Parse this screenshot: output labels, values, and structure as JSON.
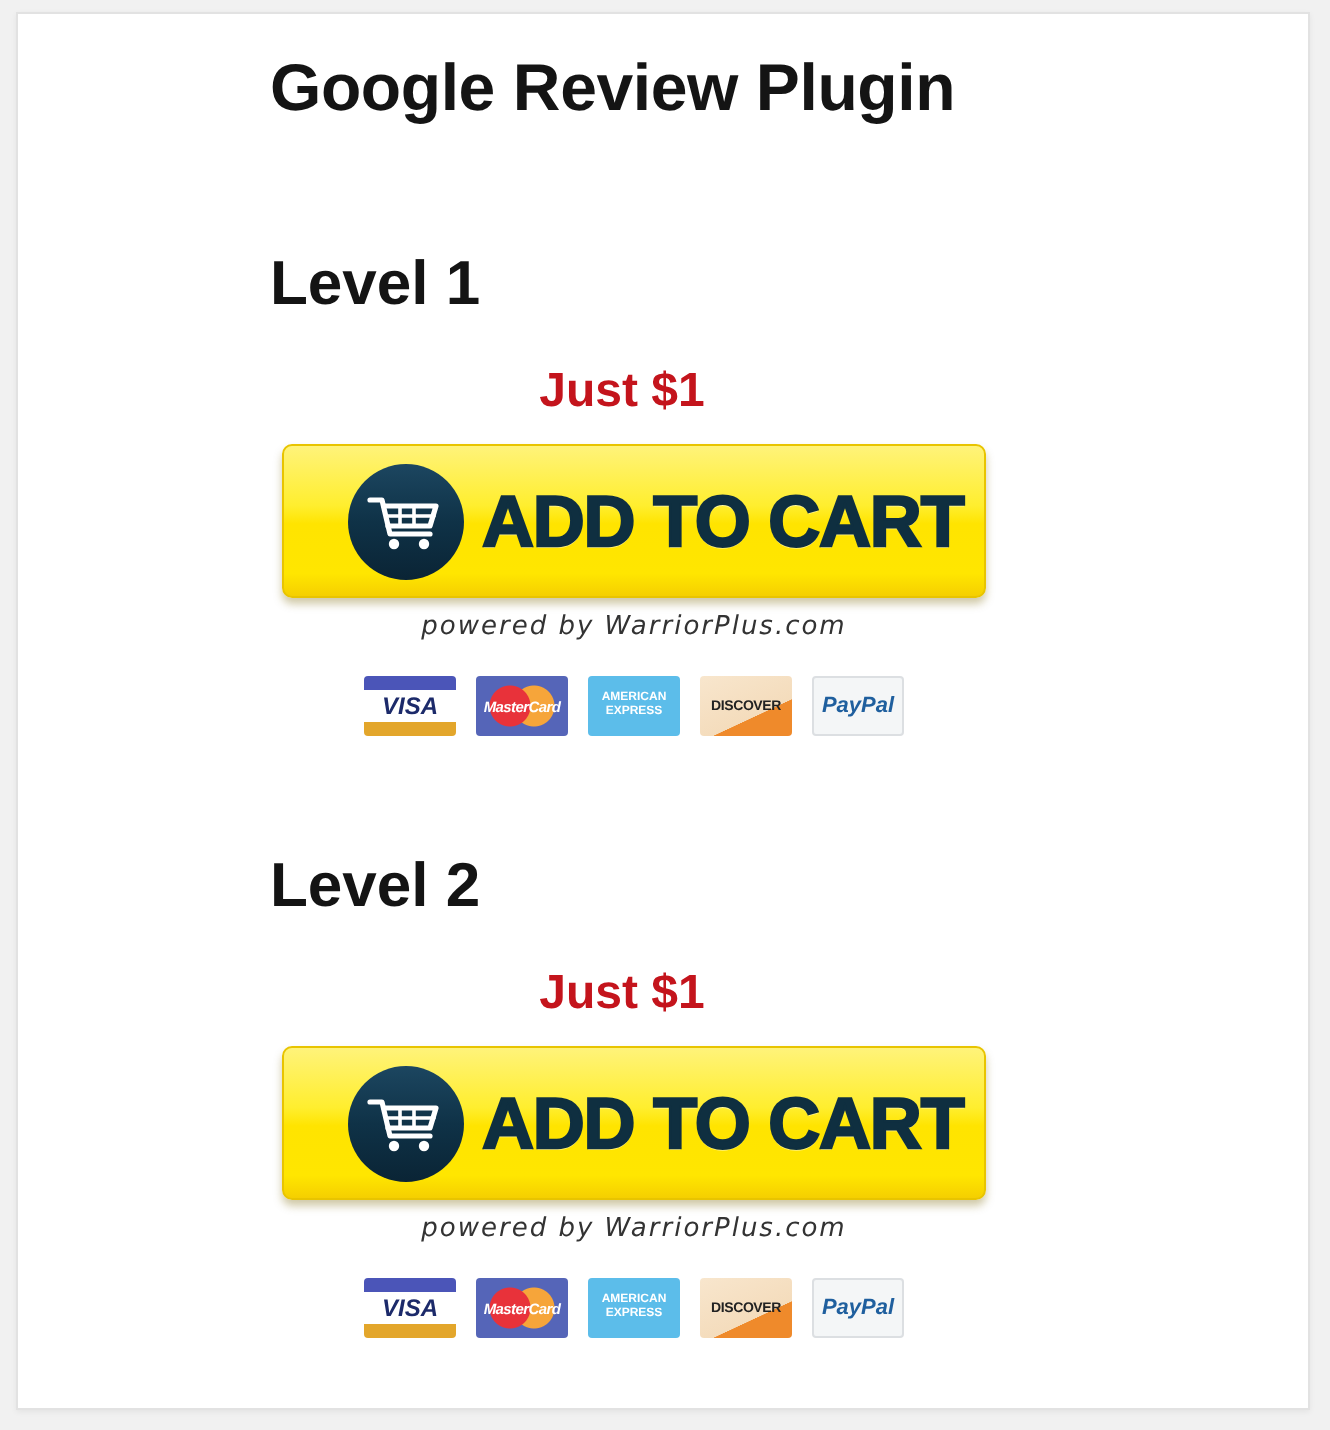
{
  "title": "Google Review Plugin",
  "levels": [
    {
      "heading": "Level 1",
      "price": "Just $1",
      "button": "ADD TO CART",
      "powered_by": "powered by WarriorPlus.com",
      "payment_methods": [
        {
          "kind": "visa",
          "label": "VISA"
        },
        {
          "kind": "mastercard",
          "label": "MasterCard"
        },
        {
          "kind": "amex",
          "label": "AMERICAN EXPRESS"
        },
        {
          "kind": "discover",
          "label": "DISCOVER"
        },
        {
          "kind": "paypal",
          "label": "PayPal"
        }
      ]
    },
    {
      "heading": "Level 2",
      "price": "Just $1",
      "button": "ADD TO CART",
      "powered_by": "powered by WarriorPlus.com",
      "payment_methods": [
        {
          "kind": "visa",
          "label": "VISA"
        },
        {
          "kind": "mastercard",
          "label": "MasterCard"
        },
        {
          "kind": "amex",
          "label": "AMERICAN EXPRESS"
        },
        {
          "kind": "discover",
          "label": "DISCOVER"
        },
        {
          "kind": "paypal",
          "label": "PayPal"
        }
      ]
    }
  ]
}
